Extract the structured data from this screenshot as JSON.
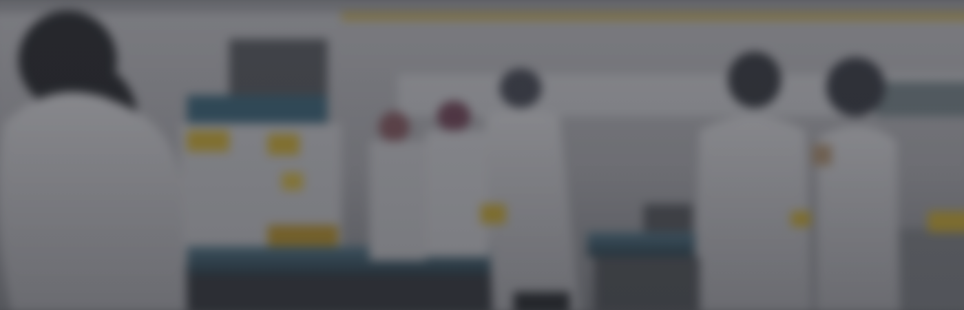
{
  "hero": {
    "image_description_name": "blurred-laboratory-background",
    "colors": {
      "base": "#6f7074",
      "wall": "#c9c8cc",
      "coat": "#d8d7db",
      "bench": "#4a6f84",
      "accent_yellow": "#d9b73a",
      "overlay": "#26282e"
    }
  }
}
